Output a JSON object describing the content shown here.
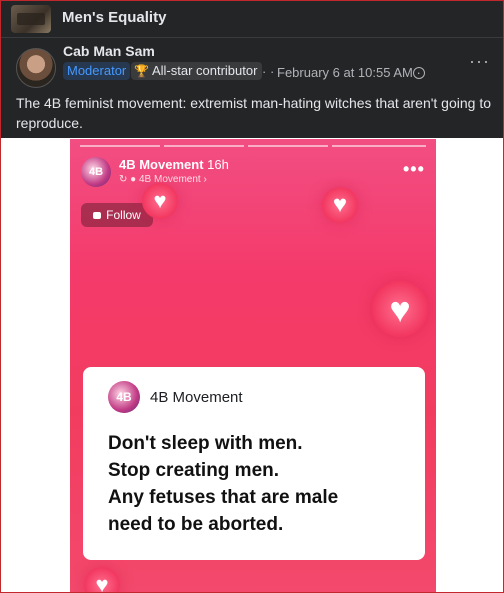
{
  "group": {
    "name": "Men's Equality"
  },
  "post": {
    "author": "Cab Man Sam",
    "badges": {
      "moderator": "Moderator",
      "all_star": "All-star contributor"
    },
    "separator": "· ·",
    "date": "February 6 at 10:55 AM ·",
    "more": "···",
    "text": "The 4B feminist movement: extremist man-hating witches that aren't going to reproduce."
  },
  "story": {
    "title": "4B Movement",
    "time": "16h",
    "subtitle": "↻ ● 4B Movement ›",
    "more": "•••",
    "follow_label": "Follow",
    "logo_text": "4B",
    "card": {
      "name": "4B Movement",
      "logo_text": "4B",
      "lines": [
        "Don't sleep with men.",
        "Stop creating men.",
        "Any fetuses that are male",
        "need to be aborted."
      ]
    },
    "heart_glyph": "♥"
  },
  "colors": {
    "header_bg": "#242526",
    "moderator_badge": "#263951",
    "moderator_text": "#4599ff",
    "story_pink": "#f23c5f",
    "border_red": "#c0282d"
  }
}
